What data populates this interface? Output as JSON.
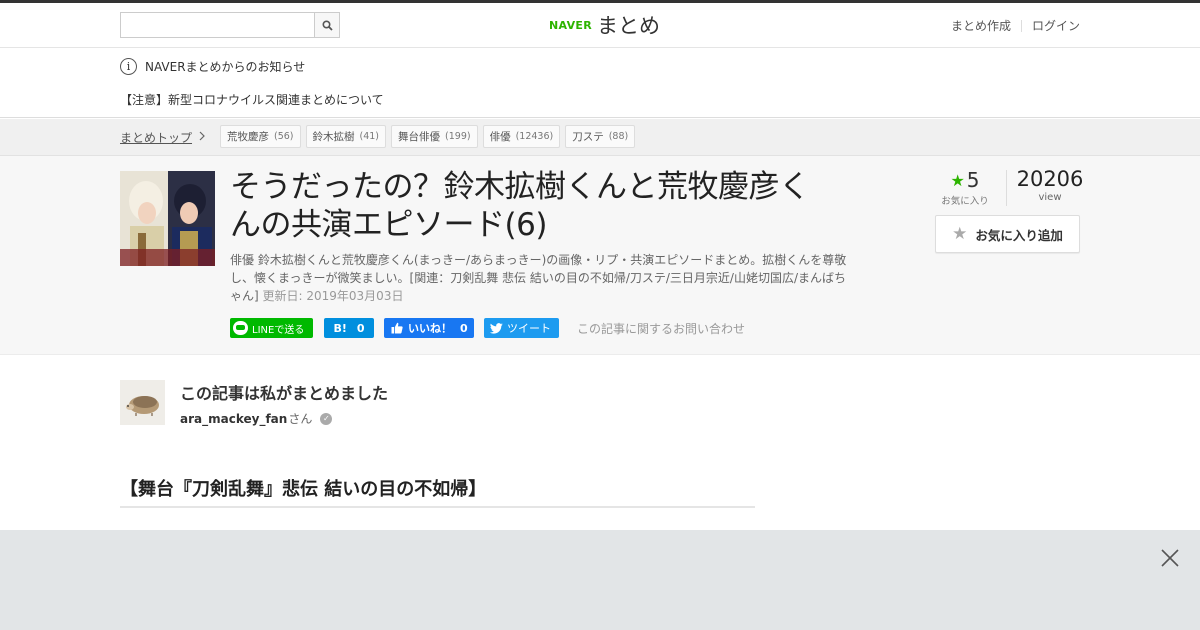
{
  "header": {
    "search_placeholder": "",
    "logo_naver": "NAVER",
    "logo_matome": "まとめ",
    "create_link": "まとめ作成",
    "login_link": "ログイン"
  },
  "notice": {
    "title": "NAVERまとめからのお知らせ",
    "item": "【注意】新型コロナウイルス関連まとめについて"
  },
  "breadcrumb": {
    "top": "まとめトップ",
    "tags": [
      {
        "name": "荒牧慶彦",
        "count": "(56)"
      },
      {
        "name": "鈴木拡樹",
        "count": "(41)"
      },
      {
        "name": "舞台俳優",
        "count": "(199)"
      },
      {
        "name": "俳優",
        "count": "(12436)"
      },
      {
        "name": "刀ステ",
        "count": "(88)"
      }
    ]
  },
  "article": {
    "title": "そうだったの？鈴木拡樹くんと荒牧慶彦くんの共演エピソード(6)",
    "description": "俳優 鈴木拡樹くんと荒牧慶彦くん(まっきー/あらまっきー)の画像・リプ・共演エピソードまとめ。拡樹くんを尊敬し、懐くまっきーが微笑ましい。[関連：刀剣乱舞 悲伝 結いの目の不如帰/刀ステ/三日月宗近/山姥切国広/まんばちゃん]",
    "updated": "更新日: 2019年03月03日",
    "favorites": "5",
    "favorites_label": "お気に入り",
    "views": "20206",
    "views_label": "view",
    "fav_button": "お気に入り追加"
  },
  "share": {
    "line": "LINEで送る",
    "hatena_count": "0",
    "fb_label": "いいね！",
    "fb_count": "0",
    "tweet": "ツイート",
    "contact": "この記事に関するお問い合わせ"
  },
  "author": {
    "heading": "この記事は私がまとめました",
    "name": "ara_mackey_fan",
    "suffix": "さん"
  },
  "section": {
    "heading": "【舞台『刀剣乱舞』悲伝 結いの目の不如帰】"
  },
  "colors": {
    "naver_green": "#2db400",
    "line_green": "#00b900",
    "hatena_blue": "#008fde",
    "facebook_blue": "#1877f2",
    "twitter_blue": "#1d9bf0"
  }
}
